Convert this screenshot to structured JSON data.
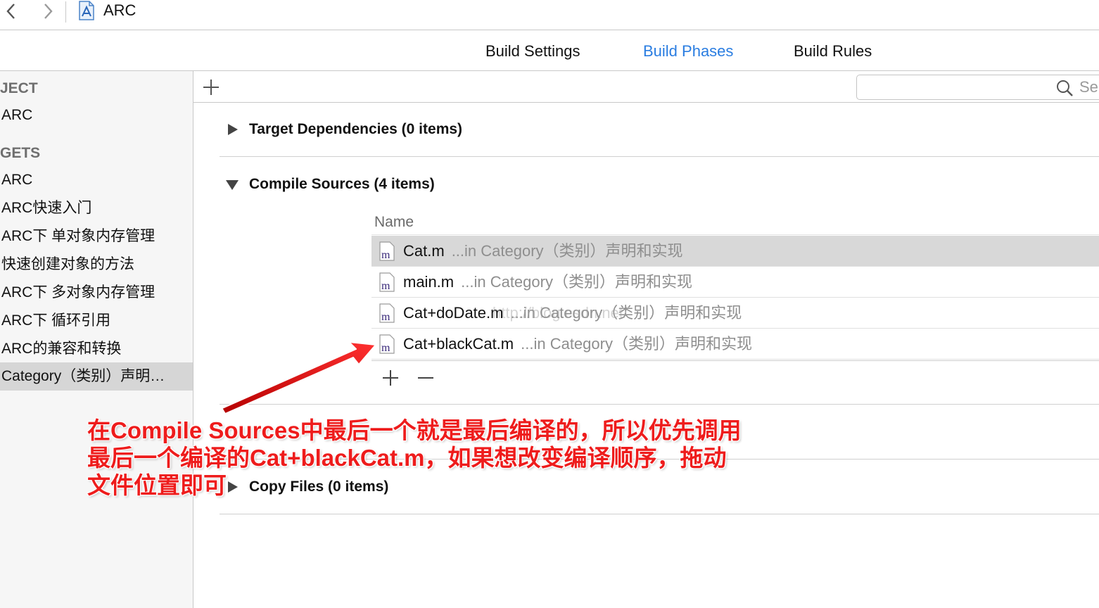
{
  "toolbar": {
    "project_title": "ARC"
  },
  "tabs": [
    {
      "label": "Build Settings",
      "active": false
    },
    {
      "label": "Build Phases",
      "active": true
    },
    {
      "label": "Build Rules",
      "active": false
    }
  ],
  "sidebar": {
    "project_header": "JECT",
    "project_items": [
      "ARC"
    ],
    "targets_header": "GETS",
    "target_items": [
      "ARC",
      "ARC快速入门",
      "ARC下 单对象内存管理",
      "快速创建对象的方法",
      "ARC下 多对象内存管理",
      "ARC下 循环引用",
      "ARC的兼容和转换"
    ],
    "selected_item": "Category（类别）声明…"
  },
  "search": {
    "placeholder": "Se"
  },
  "phases": {
    "target_dependencies": "Target Dependencies (0 items)",
    "compile_sources": "Compile Sources (4 items)",
    "copy_files": "Copy Files (0 items)"
  },
  "compile_sources": {
    "column_name": "Name",
    "files": [
      {
        "name": "Cat.m",
        "path": "...in Category（类别）声明和实现",
        "selected": true
      },
      {
        "name": "main.m",
        "path": "...in Category（类别）声明和实现",
        "selected": false
      },
      {
        "name": "Cat+doDate.m",
        "path": "...in Category（类别）声明和实现",
        "selected": false
      },
      {
        "name": "Cat+blackCat.m",
        "path": "...in Category（类别）声明和实现",
        "selected": false
      }
    ]
  },
  "annotation": {
    "lines": [
      "在Compile Sources中最后一个就是最后编译的，所以优先调用",
      "最后一个编译的Cat+blackCat.m，如果想改变编译顺序，拖动",
      "文件位置即可"
    ],
    "color": "#ee1c1c"
  },
  "watermark": "http://blog.csdn.net/",
  "colors": {
    "accent": "#2a7de1",
    "selection": "#d8d8d8"
  }
}
